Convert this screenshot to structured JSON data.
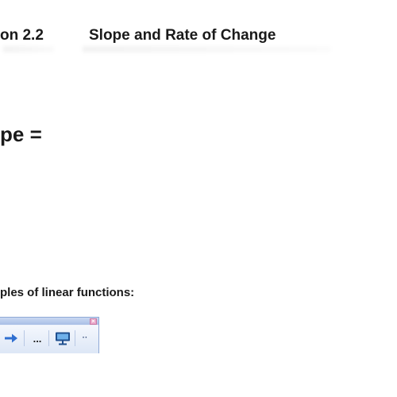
{
  "slide": {
    "section_number": "on 2.2",
    "section_title": "Slope and Rate of Change",
    "slope_label": "pe =",
    "examples_label": "ples of linear functions:"
  },
  "toolbar": {
    "close_glyph": "×",
    "buttons": [
      {
        "icon": "arrow-right-icon"
      },
      {
        "label": "..."
      },
      {
        "icon": "monitor-icon"
      },
      {
        "label": "··"
      }
    ]
  },
  "colors": {
    "toolbar_border": "#8fa9d6",
    "toolbar_titlebar": "#b6c9ea",
    "close_button": "#e9a6c8",
    "arrow_blue": "#2f6fd0"
  }
}
